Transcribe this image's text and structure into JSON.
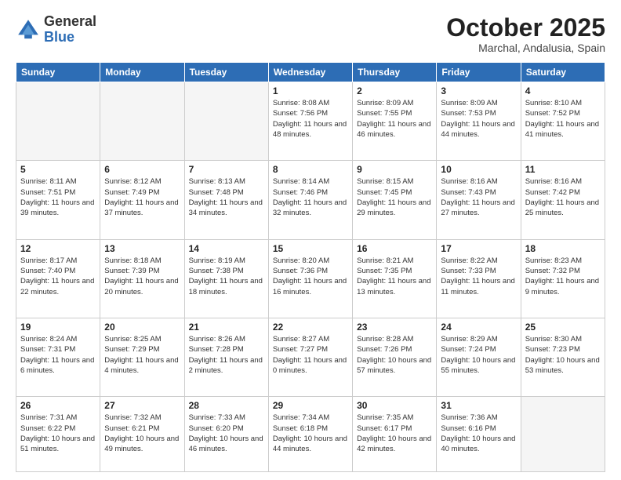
{
  "header": {
    "logo_general": "General",
    "logo_blue": "Blue",
    "month_title": "October 2025",
    "location": "Marchal, Andalusia, Spain"
  },
  "days_of_week": [
    "Sunday",
    "Monday",
    "Tuesday",
    "Wednesday",
    "Thursday",
    "Friday",
    "Saturday"
  ],
  "weeks": [
    [
      {
        "day": "",
        "info": ""
      },
      {
        "day": "",
        "info": ""
      },
      {
        "day": "",
        "info": ""
      },
      {
        "day": "1",
        "info": "Sunrise: 8:08 AM\nSunset: 7:56 PM\nDaylight: 11 hours and 48 minutes."
      },
      {
        "day": "2",
        "info": "Sunrise: 8:09 AM\nSunset: 7:55 PM\nDaylight: 11 hours and 46 minutes."
      },
      {
        "day": "3",
        "info": "Sunrise: 8:09 AM\nSunset: 7:53 PM\nDaylight: 11 hours and 44 minutes."
      },
      {
        "day": "4",
        "info": "Sunrise: 8:10 AM\nSunset: 7:52 PM\nDaylight: 11 hours and 41 minutes."
      }
    ],
    [
      {
        "day": "5",
        "info": "Sunrise: 8:11 AM\nSunset: 7:51 PM\nDaylight: 11 hours and 39 minutes."
      },
      {
        "day": "6",
        "info": "Sunrise: 8:12 AM\nSunset: 7:49 PM\nDaylight: 11 hours and 37 minutes."
      },
      {
        "day": "7",
        "info": "Sunrise: 8:13 AM\nSunset: 7:48 PM\nDaylight: 11 hours and 34 minutes."
      },
      {
        "day": "8",
        "info": "Sunrise: 8:14 AM\nSunset: 7:46 PM\nDaylight: 11 hours and 32 minutes."
      },
      {
        "day": "9",
        "info": "Sunrise: 8:15 AM\nSunset: 7:45 PM\nDaylight: 11 hours and 29 minutes."
      },
      {
        "day": "10",
        "info": "Sunrise: 8:16 AM\nSunset: 7:43 PM\nDaylight: 11 hours and 27 minutes."
      },
      {
        "day": "11",
        "info": "Sunrise: 8:16 AM\nSunset: 7:42 PM\nDaylight: 11 hours and 25 minutes."
      }
    ],
    [
      {
        "day": "12",
        "info": "Sunrise: 8:17 AM\nSunset: 7:40 PM\nDaylight: 11 hours and 22 minutes."
      },
      {
        "day": "13",
        "info": "Sunrise: 8:18 AM\nSunset: 7:39 PM\nDaylight: 11 hours and 20 minutes."
      },
      {
        "day": "14",
        "info": "Sunrise: 8:19 AM\nSunset: 7:38 PM\nDaylight: 11 hours and 18 minutes."
      },
      {
        "day": "15",
        "info": "Sunrise: 8:20 AM\nSunset: 7:36 PM\nDaylight: 11 hours and 16 minutes."
      },
      {
        "day": "16",
        "info": "Sunrise: 8:21 AM\nSunset: 7:35 PM\nDaylight: 11 hours and 13 minutes."
      },
      {
        "day": "17",
        "info": "Sunrise: 8:22 AM\nSunset: 7:33 PM\nDaylight: 11 hours and 11 minutes."
      },
      {
        "day": "18",
        "info": "Sunrise: 8:23 AM\nSunset: 7:32 PM\nDaylight: 11 hours and 9 minutes."
      }
    ],
    [
      {
        "day": "19",
        "info": "Sunrise: 8:24 AM\nSunset: 7:31 PM\nDaylight: 11 hours and 6 minutes."
      },
      {
        "day": "20",
        "info": "Sunrise: 8:25 AM\nSunset: 7:29 PM\nDaylight: 11 hours and 4 minutes."
      },
      {
        "day": "21",
        "info": "Sunrise: 8:26 AM\nSunset: 7:28 PM\nDaylight: 11 hours and 2 minutes."
      },
      {
        "day": "22",
        "info": "Sunrise: 8:27 AM\nSunset: 7:27 PM\nDaylight: 11 hours and 0 minutes."
      },
      {
        "day": "23",
        "info": "Sunrise: 8:28 AM\nSunset: 7:26 PM\nDaylight: 10 hours and 57 minutes."
      },
      {
        "day": "24",
        "info": "Sunrise: 8:29 AM\nSunset: 7:24 PM\nDaylight: 10 hours and 55 minutes."
      },
      {
        "day": "25",
        "info": "Sunrise: 8:30 AM\nSunset: 7:23 PM\nDaylight: 10 hours and 53 minutes."
      }
    ],
    [
      {
        "day": "26",
        "info": "Sunrise: 7:31 AM\nSunset: 6:22 PM\nDaylight: 10 hours and 51 minutes."
      },
      {
        "day": "27",
        "info": "Sunrise: 7:32 AM\nSunset: 6:21 PM\nDaylight: 10 hours and 49 minutes."
      },
      {
        "day": "28",
        "info": "Sunrise: 7:33 AM\nSunset: 6:20 PM\nDaylight: 10 hours and 46 minutes."
      },
      {
        "day": "29",
        "info": "Sunrise: 7:34 AM\nSunset: 6:18 PM\nDaylight: 10 hours and 44 minutes."
      },
      {
        "day": "30",
        "info": "Sunrise: 7:35 AM\nSunset: 6:17 PM\nDaylight: 10 hours and 42 minutes."
      },
      {
        "day": "31",
        "info": "Sunrise: 7:36 AM\nSunset: 6:16 PM\nDaylight: 10 hours and 40 minutes."
      },
      {
        "day": "",
        "info": ""
      }
    ]
  ]
}
